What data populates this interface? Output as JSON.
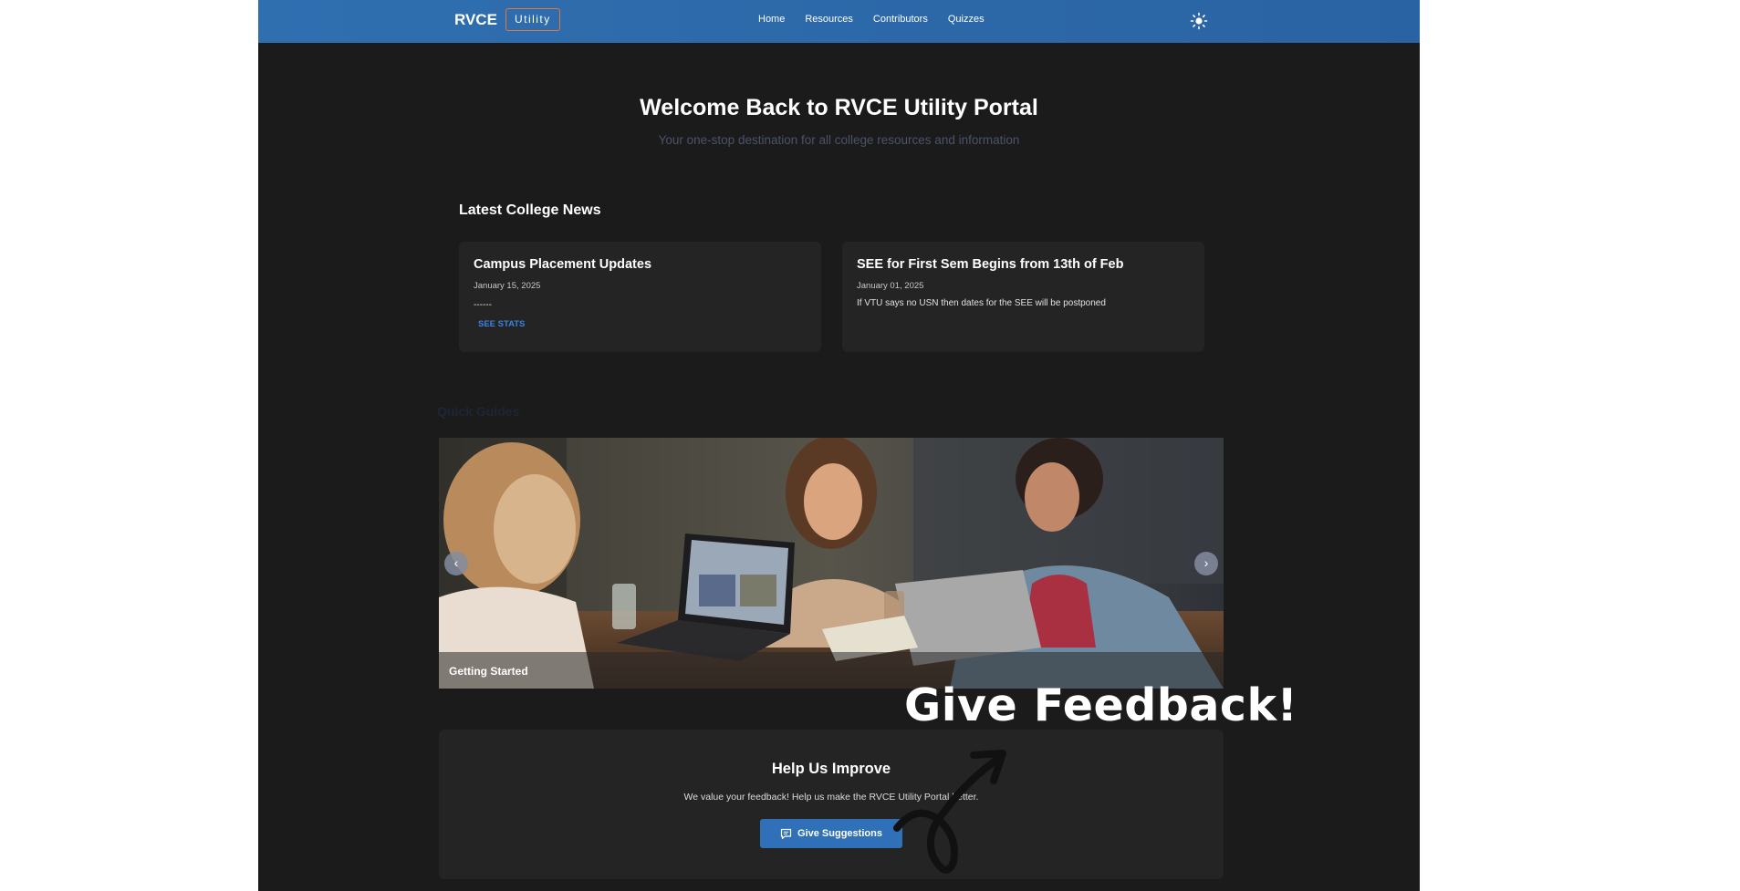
{
  "navbar": {
    "brand": "RVCE",
    "badge": "Utility",
    "links": [
      "Home",
      "Resources",
      "Contributors",
      "Quizzes"
    ],
    "theme_icon": "sun-icon"
  },
  "hero": {
    "title": "Welcome Back to RVCE Utility Portal",
    "subtitle": "Your one-stop destination for all college resources and information"
  },
  "news": {
    "heading": "Latest College News",
    "items": [
      {
        "title": "Campus Placement Updates",
        "date": "January 15, 2025",
        "body": "------",
        "link": "SEE STATS"
      },
      {
        "title": "SEE for First Sem Begins from 13th of Feb",
        "date": "January 01, 2025",
        "body": "If VTU says no USN then dates for the SEE will be postponed"
      }
    ]
  },
  "carousel": {
    "heading": "Quick Guides",
    "caption": "Getting Started",
    "prev_icon": "chevron-left-icon",
    "next_icon": "chevron-right-icon"
  },
  "feedback": {
    "title": "Help Us Improve",
    "description": "We value your feedback! Help us make the RVCE Utility Portal better.",
    "button": "Give Suggestions",
    "button_icon": "message-icon"
  },
  "annotation": {
    "text": "Give Feedback!",
    "icon": "curly-arrow-icon"
  },
  "colors": {
    "navbar": "#2f6fb0",
    "background": "#1b1b1b",
    "card": "#242424",
    "accent": "#2f70b8",
    "badge_border": "#e07a3c"
  }
}
